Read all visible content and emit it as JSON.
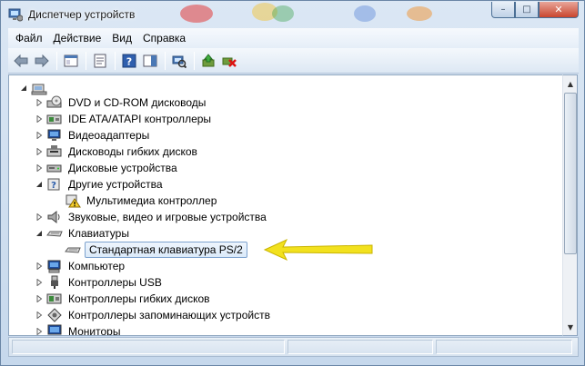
{
  "window": {
    "title": "Диспетчер устройств",
    "buttons": {
      "minimize": "–",
      "maximize": "□",
      "close": "✕"
    }
  },
  "menu": [
    "Файл",
    "Действие",
    "Вид",
    "Справка"
  ],
  "toolbar": {
    "icons": [
      "back-icon",
      "forward-icon",
      "show-hide-console-tree-icon",
      "properties-icon",
      "help-icon",
      "action-pane-icon",
      "scan-hardware-icon",
      "update-driver-icon",
      "uninstall-icon"
    ]
  },
  "tree": {
    "nodes": [
      {
        "label": "",
        "icon": "computer-root-icon",
        "depth": 0,
        "expanded": true
      },
      {
        "label": "DVD и CD-ROM дисководы",
        "icon": "dvd-drive-icon",
        "depth": 1
      },
      {
        "label": "IDE ATA/ATAPI контроллеры",
        "icon": "ide-controller-icon",
        "depth": 1
      },
      {
        "label": "Видеоадаптеры",
        "icon": "display-adapter-icon",
        "depth": 1
      },
      {
        "label": "Дисководы гибких дисков",
        "icon": "floppy-drive-icon",
        "depth": 1
      },
      {
        "label": "Дисковые устройства",
        "icon": "disk-drive-icon",
        "depth": 1
      },
      {
        "label": "Другие устройства",
        "icon": "other-devices-icon",
        "depth": 1,
        "expanded": true
      },
      {
        "label": "Мультимедиа контроллер",
        "icon": "warning-device-icon",
        "depth": 2
      },
      {
        "label": "Звуковые, видео и игровые устройства",
        "icon": "sound-icon",
        "depth": 1
      },
      {
        "label": "Клавиатуры",
        "icon": "keyboard-icon",
        "depth": 1,
        "expanded": true
      },
      {
        "label": "Стандартная клавиатура PS/2",
        "icon": "keyboard-icon",
        "depth": 2,
        "selected": true
      },
      {
        "label": "Компьютер",
        "icon": "computer-icon",
        "depth": 1
      },
      {
        "label": "Контроллеры USB",
        "icon": "usb-icon",
        "depth": 1
      },
      {
        "label": "Контроллеры гибких дисков",
        "icon": "floppy-controller-icon",
        "depth": 1
      },
      {
        "label": "Контроллеры запоминающих устройств",
        "icon": "storage-controller-icon",
        "depth": 1
      },
      {
        "label": "Мониторы",
        "icon": "monitor-icon",
        "depth": 1
      }
    ]
  },
  "colors": {
    "arrow": "#f2e11e",
    "selection_border": "#7da2ce"
  }
}
